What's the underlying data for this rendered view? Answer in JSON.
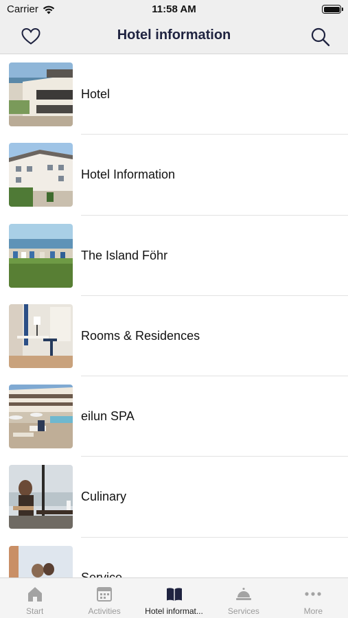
{
  "status_bar": {
    "carrier": "Carrier",
    "time": "11:58 AM"
  },
  "nav": {
    "title": "Hotel information",
    "left_icon": "heart-icon",
    "right_icon": "search-icon"
  },
  "list": {
    "items": [
      {
        "label": "Hotel",
        "thumbnail": "hotel-building-photo"
      },
      {
        "label": "Hotel Information",
        "thumbnail": "hotel-facade-photo"
      },
      {
        "label": "The Island Föhr",
        "thumbnail": "beach-photo"
      },
      {
        "label": "Rooms & Residences",
        "thumbnail": "room-interior-photo"
      },
      {
        "label": "eilun SPA",
        "thumbnail": "spa-pool-photo"
      },
      {
        "label": "Culinary",
        "thumbnail": "dining-photo"
      },
      {
        "label": "Service",
        "thumbnail": "service-photo"
      }
    ]
  },
  "tab_bar": {
    "tabs": [
      {
        "label": "Start",
        "icon": "house-icon",
        "active": false
      },
      {
        "label": "Activities",
        "icon": "calendar-icon",
        "active": false
      },
      {
        "label": "Hotel informat...",
        "icon": "book-icon",
        "active": true
      },
      {
        "label": "Services",
        "icon": "service-bell-icon",
        "active": false
      },
      {
        "label": "More",
        "icon": "more-dots-icon",
        "active": false
      }
    ]
  },
  "colors": {
    "title": "#1f2340",
    "tab_inactive": "#9a9a9a",
    "tab_active": "#1a1a1a",
    "bar_background": "#efefef"
  }
}
